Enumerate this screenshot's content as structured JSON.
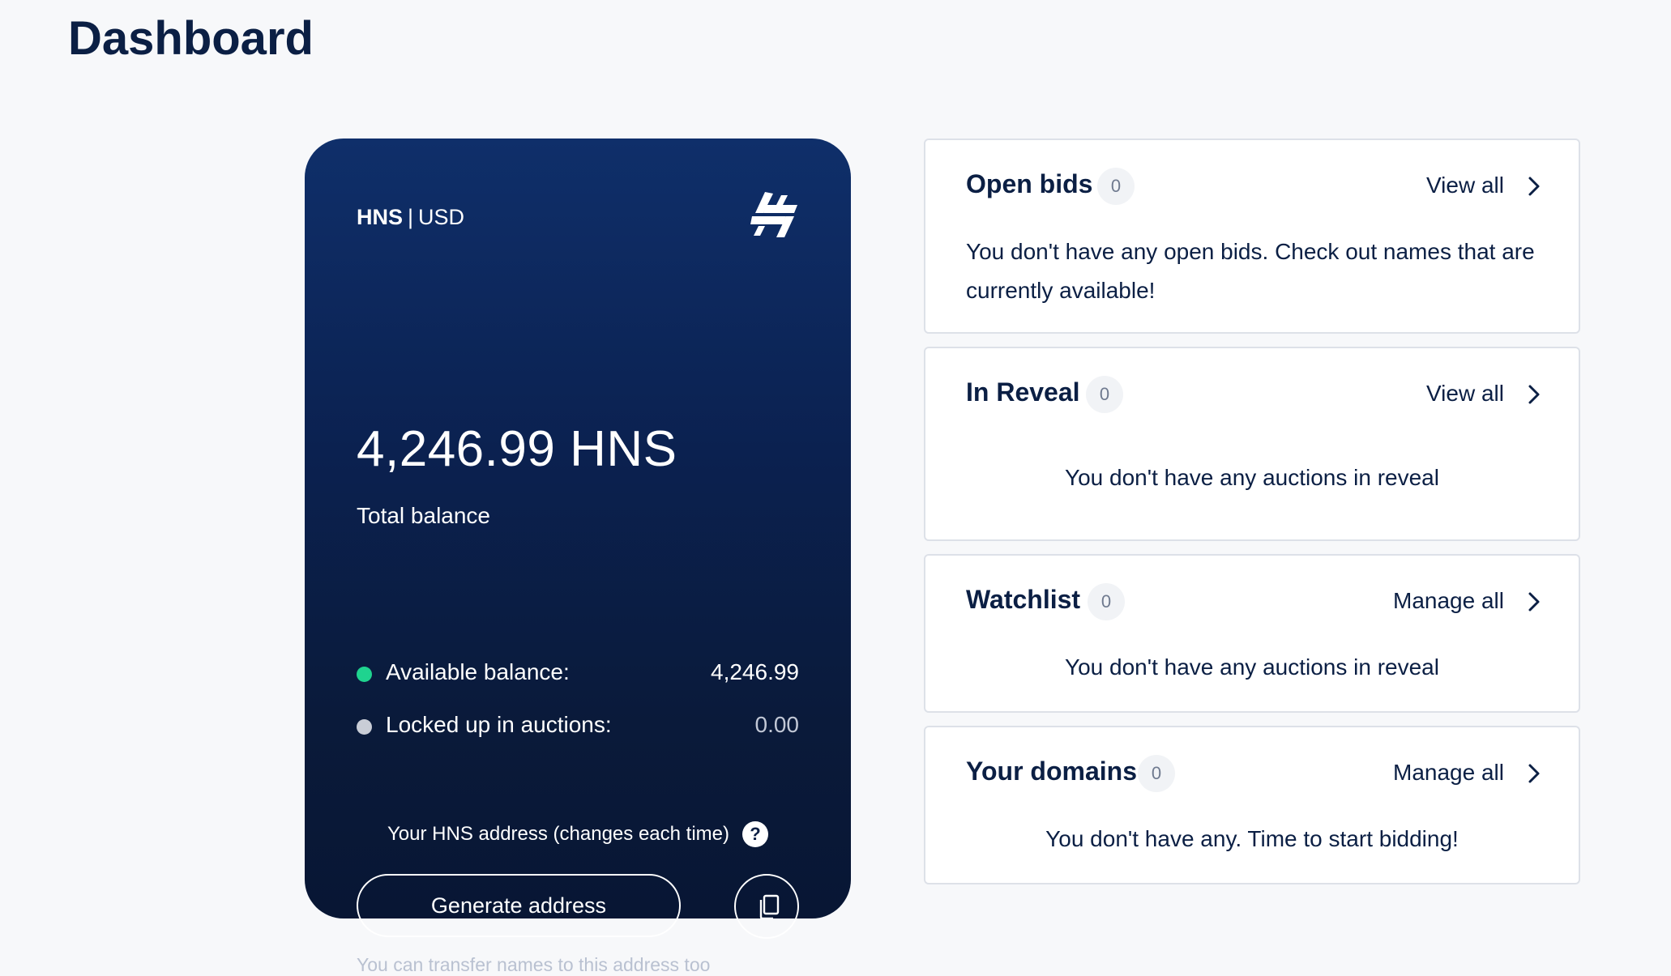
{
  "page": {
    "title": "Dashboard"
  },
  "balance_card": {
    "currency_primary": "HNS",
    "currency_separator": "|",
    "currency_secondary": "USD",
    "logo_icon": "handshake-logo-icon",
    "total_amount": "4,246.99 HNS",
    "total_label": "Total balance",
    "available_label": "Available balance:",
    "available_value": "4,246.99",
    "available_color": "#1fd38f",
    "locked_label": "Locked up in auctions:",
    "locked_value": "0.00",
    "locked_color": "#c9cdd6",
    "address_label": "Your HNS address (changes each time)",
    "help_icon_text": "?",
    "generate_button": "Generate address",
    "copy_icon": "copy-icon",
    "transfer_note": "You can transfer names to this address too"
  },
  "panels": {
    "open_bids": {
      "title": "Open bids",
      "count": "0",
      "link": "View all",
      "message": "You don't have any open bids. Check out names that are currently available!"
    },
    "in_reveal": {
      "title": "In Reveal",
      "count": "0",
      "link": "View all",
      "message": "You don't have any auctions in reveal"
    },
    "watchlist": {
      "title": "Watchlist",
      "count": "0",
      "link": "Manage all",
      "message": "You don't have any auctions in reveal"
    },
    "your_domains": {
      "title": "Your domains",
      "count": "0",
      "link": "Manage all",
      "message": "You don't have any. Time to start bidding!"
    }
  },
  "colors": {
    "brand_dark": "#0b1f44",
    "card_gradient_top": "#0f2f6a",
    "card_gradient_bottom": "#081634",
    "page_background": "#f7f8fa"
  }
}
